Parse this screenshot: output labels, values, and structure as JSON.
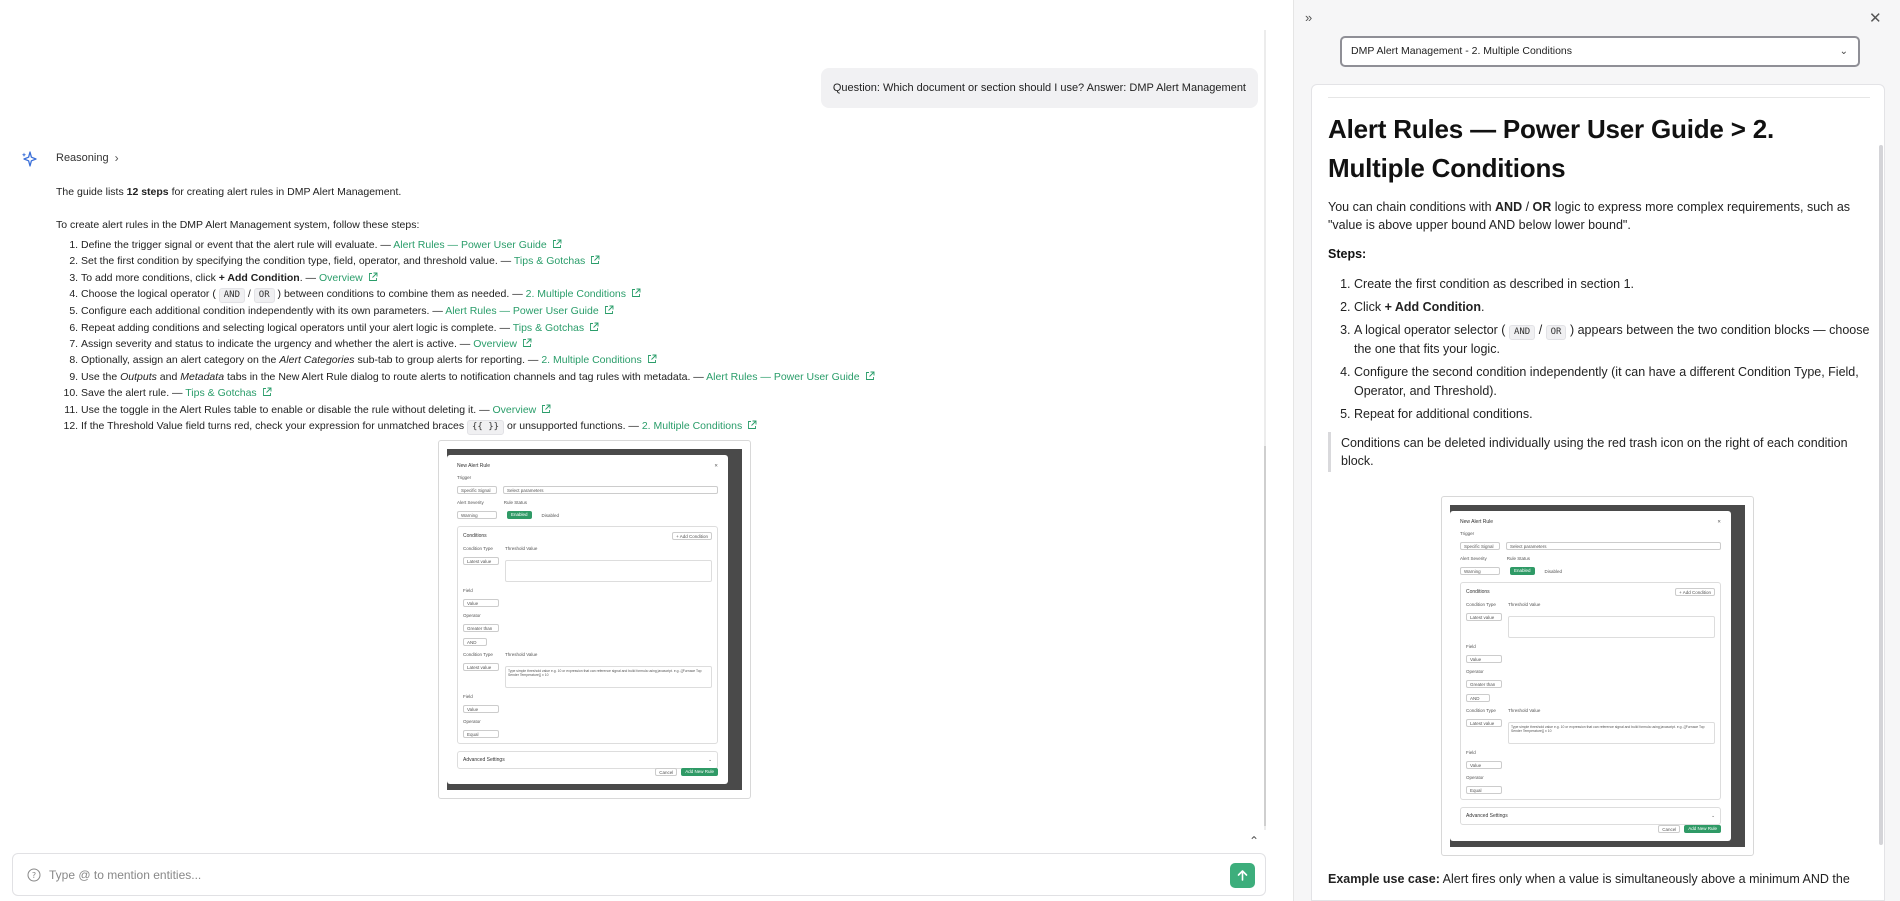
{
  "chat": {
    "user_message": "Question: Which document or section should I use? Answer: DMP Alert Management",
    "reasoning_label": "Reasoning",
    "summary_prefix": "The guide lists ",
    "summary_bold": "12 steps",
    "summary_suffix": " for creating alert rules in DMP Alert Management.",
    "intro": "To create alert rules in the DMP Alert Management system, follow these steps:",
    "steps": [
      {
        "parts": [
          {
            "t": "Define the trigger signal or event that the alert rule will evaluate. — "
          }
        ],
        "ref": "Alert Rules — Power User Guide"
      },
      {
        "parts": [
          {
            "t": "Set the first condition by specifying the condition type, field, operator, and threshold value. — "
          }
        ],
        "ref": "Tips & Gotchas"
      },
      {
        "parts": [
          {
            "t": "To add more conditions, click "
          },
          {
            "t": "+ Add Condition",
            "b": true
          },
          {
            "t": ". — "
          }
        ],
        "ref": "Overview"
      },
      {
        "parts": [
          {
            "t": "Choose the logical operator ( "
          },
          {
            "t": "AND",
            "c": true
          },
          {
            "t": " / "
          },
          {
            "t": "OR",
            "c": true
          },
          {
            "t": " ) between conditions to combine them as needed. — "
          }
        ],
        "ref": "2. Multiple Conditions"
      },
      {
        "parts": [
          {
            "t": "Configure each additional condition independently with its own parameters. — "
          }
        ],
        "ref": "Alert Rules — Power User Guide"
      },
      {
        "parts": [
          {
            "t": "Repeat adding conditions and selecting logical operators until your alert logic is complete. — "
          }
        ],
        "ref": "Tips & Gotchas"
      },
      {
        "parts": [
          {
            "t": "Assign severity and status to indicate the urgency and whether the alert is active. — "
          }
        ],
        "ref": "Overview"
      },
      {
        "parts": [
          {
            "t": "Optionally, assign an alert category on the "
          },
          {
            "t": "Alert Categories",
            "i": true
          },
          {
            "t": " sub-tab to group alerts for reporting. — "
          }
        ],
        "ref": "2. Multiple Conditions"
      },
      {
        "parts": [
          {
            "t": "Use the "
          },
          {
            "t": "Outputs",
            "i": true
          },
          {
            "t": " and "
          },
          {
            "t": "Metadata",
            "i": true
          },
          {
            "t": " tabs in the New Alert Rule dialog to route alerts to notification channels and tag rules with metadata. — "
          }
        ],
        "ref": "Alert Rules — Power User Guide"
      },
      {
        "parts": [
          {
            "t": "Save the alert rule. — "
          }
        ],
        "ref": "Tips & Gotchas"
      },
      {
        "parts": [
          {
            "t": "Use the toggle in the Alert Rules table to enable or disable the rule without deleting it. — "
          }
        ],
        "ref": "Overview"
      },
      {
        "parts": [
          {
            "t": "If the Threshold Value field turns red, check your expression for unmatched braces "
          },
          {
            "t": "{{ }}",
            "c": true
          },
          {
            "t": " or unsupported functions. — "
          }
        ],
        "ref": "2. Multiple Conditions"
      }
    ],
    "input_placeholder": "Type @ to mention entities..."
  },
  "doc": {
    "selected": "DMP Alert Management - 2. Multiple Conditions",
    "title": "Alert Rules — Power User Guide > 2. Multiple Conditions",
    "intro_a": "You can chain conditions with ",
    "intro_and": "AND",
    "intro_slash": " / ",
    "intro_or": "OR",
    "intro_b": " logic to express more complex requirements, such as \"value is above upper bound AND below lower bound\".",
    "steps_heading": "Steps:",
    "steps": [
      {
        "parts": [
          {
            "t": "Create the first condition as described in section 1."
          }
        ]
      },
      {
        "parts": [
          {
            "t": "Click "
          },
          {
            "t": "+ Add Condition",
            "b": true
          },
          {
            "t": "."
          }
        ]
      },
      {
        "parts": [
          {
            "t": "A logical operator selector ( "
          },
          {
            "t": "AND",
            "c": true
          },
          {
            "t": " / "
          },
          {
            "t": "OR",
            "c": true
          },
          {
            "t": " ) appears between the two condition blocks — choose the one that fits your logic."
          }
        ]
      },
      {
        "parts": [
          {
            "t": "Configure the second condition independently (it can have a different Condition Type, Field, Operator, and Threshold)."
          }
        ]
      },
      {
        "parts": [
          {
            "t": "Repeat for additional conditions."
          }
        ]
      }
    ],
    "note": "Conditions can be deleted individually using the red trash icon on the right of each condition block.",
    "example_label": "Example use case:",
    "example_text": " Alert fires only when a value is simultaneously above a minimum AND the"
  },
  "dialog_shot": {
    "title": "New Alert Rule",
    "trigger_label": "Trigger",
    "trigger_type": "Specific Signal",
    "trigger_param": "Select parameters",
    "severity_label": "Alert Severity",
    "severity_value": "Warning",
    "status_label": "Rule Status",
    "status_enabled": "Enabled",
    "status_disabled": "Disabled",
    "conditions_label": "Conditions",
    "add_condition": "+ Add Condition",
    "cond_type_label": "Condition Type",
    "cond_type_value": "Latest value",
    "threshold_label": "Threshold Value",
    "field_label": "Field",
    "field_value": "Value",
    "operator_label": "Operator",
    "op1_value": "Greater than",
    "logic_value": "AND",
    "threshold_hint": "Type simple threshold value e.g. 10 or expression that can reference signal and build formula using javascript. e.g. {{Furnace Top Sender Temperature}} x 10",
    "op2_value": "Equal",
    "advanced": "Advanced Settings",
    "cancel": "Cancel",
    "submit": "Add New Rule"
  },
  "colors": {
    "link": "#2a9d6a",
    "send_button": "#3dae7c"
  }
}
